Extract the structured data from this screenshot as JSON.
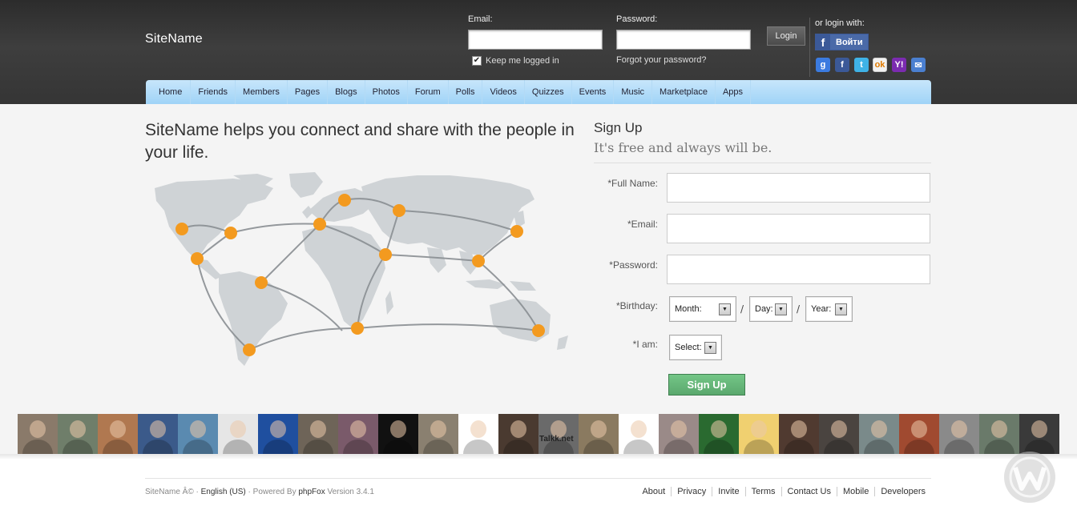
{
  "header": {
    "site_name": "SiteName",
    "email_label": "Email:",
    "password_label": "Password:",
    "keep_logged_in": "Keep me logged in",
    "forgot_password": "Forgot your password?",
    "login_button": "Login",
    "or_login_with": "or login with:",
    "facebook_button": "Войти",
    "social_icons": [
      "google-icon",
      "facebook-icon",
      "twitter-icon",
      "odnoklassniki-icon",
      "yahoo-icon",
      "windows-live-icon"
    ]
  },
  "nav": {
    "items": [
      "Home",
      "Friends",
      "Members",
      "Pages",
      "Blogs",
      "Photos",
      "Forum",
      "Polls",
      "Videos",
      "Quizzes",
      "Events",
      "Music",
      "Marketplace",
      "Apps"
    ]
  },
  "main": {
    "tagline": "SiteName helps you connect and share with the people in your life."
  },
  "signup": {
    "title": "Sign Up",
    "subtitle": "It's free and always will be.",
    "full_name_label": "*Full Name:",
    "email_label": "*Email:",
    "password_label": "*Password:",
    "birthday_label": "*Birthday:",
    "iam_label": "*I am:",
    "month": "Month:",
    "day": "Day:",
    "year": "Year:",
    "select": "Select:",
    "separator": "/",
    "button": "Sign Up"
  },
  "avatars": {
    "colors": [
      "#8a7a6a",
      "#6f7e6a",
      "#b07850",
      "#3b5a8a",
      "#5a8ab0",
      "#e6e6e6",
      "#1f4f9f",
      "#6e6458",
      "#7a5a6a",
      "#111111",
      "#8a8070",
      "#ffffff",
      "#4a3a30",
      "#6a6a6a",
      "#8a7a60",
      "#ffffff",
      "#9a8a88",
      "#2a6a30",
      "#f0d070",
      "#503a30",
      "#4a4440",
      "#7a8a8a",
      "#a04a30",
      "#8a8a8a",
      "#6a7a6a",
      "#3a3a3a"
    ],
    "labels": [
      "Talkk.net"
    ]
  },
  "footer": {
    "copyright": "SiteName Â© ·",
    "language": "English (US)",
    "powered_by": "· Powered By",
    "powered_brand": "phpFox",
    "version": "Version 3.4.1",
    "links": [
      "About",
      "Privacy",
      "Invite",
      "Terms",
      "Contact Us",
      "Mobile",
      "Developers"
    ]
  },
  "colors": {
    "header_bg": "#353535",
    "nav_bg": "#9fd3f7",
    "signup_button": "#5aa86d",
    "map_land": "#cfd3d6",
    "map_dot": "#f39a1f"
  }
}
